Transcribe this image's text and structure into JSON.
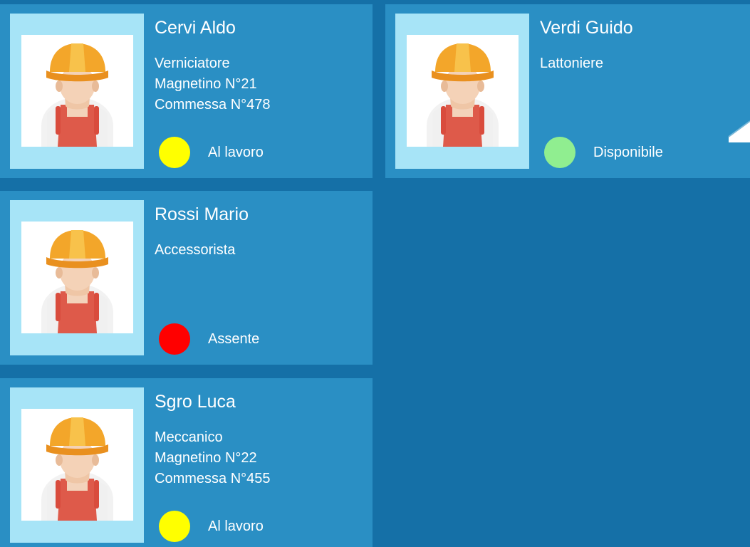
{
  "workers": [
    {
      "name": "Cervi Aldo",
      "role": "Verniciatore",
      "magnet": "Magnetino N°21",
      "order": "Commessa N°478",
      "status_label": "Al lavoro",
      "status_color": "#ffff00",
      "avatar_icon": "construction-worker-icon"
    },
    {
      "name": "Verdi Guido",
      "role": "Lattoniere",
      "magnet": "",
      "order": "",
      "status_label": "Disponibile",
      "status_color": "#90ee90",
      "avatar_icon": "construction-worker-icon"
    },
    {
      "name": "Rossi Mario",
      "role": "Accessorista",
      "magnet": "",
      "order": "",
      "status_label": "Assente",
      "status_color": "#ff0000",
      "avatar_icon": "construction-worker-icon"
    },
    {
      "name": "Sgro Luca",
      "role": "Meccanico",
      "magnet": "Magnetino N°22",
      "order": "Commessa N°455",
      "status_label": "Al lavoro",
      "status_color": "#ffff00",
      "avatar_icon": "construction-worker-icon"
    }
  ],
  "colors": {
    "background": "#1570a7",
    "card": "#2a8fc4",
    "photo_frame": "#a7e4f7"
  }
}
